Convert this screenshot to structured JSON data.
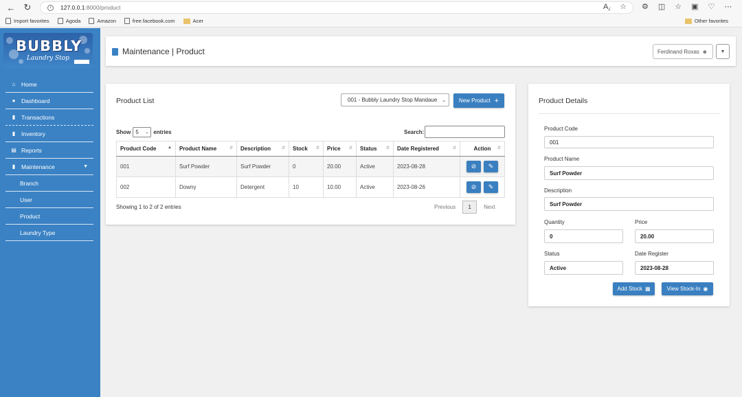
{
  "browser": {
    "url_host": "127.0.0.1",
    "url_path": ":8000/product",
    "bookmarks": [
      "Import favorites",
      "Agoda",
      "Amazon",
      "free.facebook.com",
      "Acer"
    ],
    "other_favorites": "Other favorites"
  },
  "logo": {
    "title": "BUBBLY",
    "subtitle": "Laundry Stop"
  },
  "sidebar": {
    "items": [
      {
        "label": "Home",
        "icon": "home-icon"
      },
      {
        "label": "Dashboard",
        "icon": "dashboard-icon"
      },
      {
        "label": "Transactions",
        "icon": "document-icon"
      },
      {
        "label": "Inventory",
        "icon": "document-icon"
      },
      {
        "label": "Reports",
        "icon": "report-icon"
      },
      {
        "label": "Maintenance",
        "icon": "document-icon"
      }
    ],
    "submenu": [
      "Branch",
      "User",
      "Product",
      "Laundry Type"
    ]
  },
  "header": {
    "title": "Maintenance | Product",
    "user": "Ferdinand Roxas"
  },
  "product_list": {
    "title": "Product List",
    "branch": "001 - Bubbly Laundry Stop Mandaue",
    "new_button": "New Product",
    "show_label": "Show",
    "entries_value": "5",
    "entries_label": "entries",
    "search_label": "Search:",
    "columns": [
      "Product Code",
      "Product Name",
      "Description",
      "Stock",
      "Price",
      "Status",
      "Date Registered",
      "Action"
    ],
    "rows": [
      [
        "001",
        "Surf Powder",
        "Surf Powder",
        "0",
        "20.00",
        "Active",
        "2023-08-28"
      ],
      [
        "002",
        "Downy",
        "Detergent",
        "10",
        "10.00",
        "Active",
        "2023-08-26"
      ]
    ],
    "showing": "Showing 1 to 2 of 2 entries",
    "previous": "Previous",
    "page": "1",
    "next": "Next"
  },
  "product_details": {
    "title": "Product Details",
    "code_label": "Product Code",
    "code": "001",
    "name_label": "Product Name",
    "name": "Surf Powder",
    "desc_label": "Description",
    "desc": "Surf Powder",
    "qty_label": "Quantity",
    "qty": "0",
    "price_label": "Price",
    "price": "20.00",
    "status_label": "Status",
    "status": "Active",
    "date_label": "Date Register",
    "date": "2023-08-28",
    "add_stock": "Add Stock",
    "view_stock": "View Stock-In"
  },
  "colors": {
    "sidebar": "#3a82c4",
    "primary_button": "#3a7fc0"
  }
}
